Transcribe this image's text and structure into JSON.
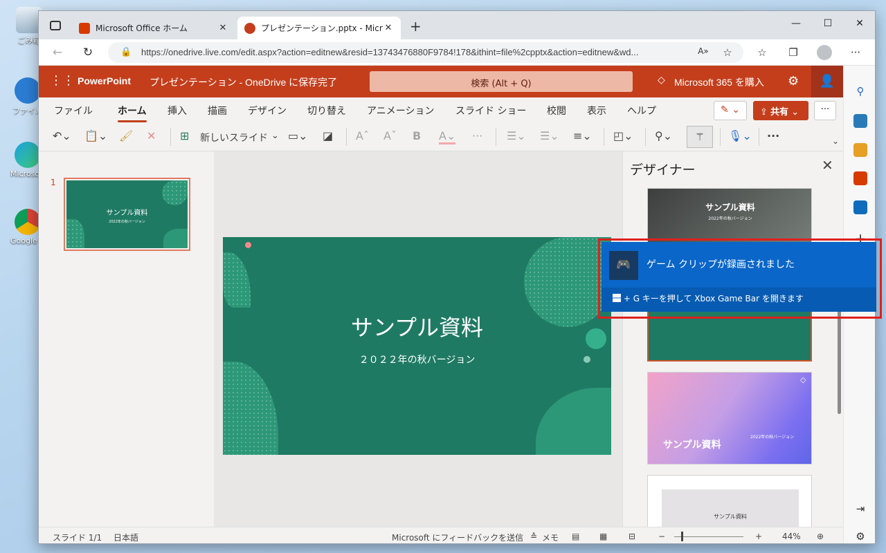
{
  "desktop": {
    "icons": [
      {
        "label": "ごみ箱"
      },
      {
        "label": "ファイル"
      },
      {
        "label": "Microsoft"
      },
      {
        "label": "Google C"
      }
    ]
  },
  "browser": {
    "tabs": [
      {
        "title": "Microsoft Office ホーム"
      },
      {
        "title": "プレゼンテーション.pptx - Microsoft PowerPoint"
      }
    ],
    "url": "https://onedrive.live.com/edit.aspx?action=editnew&resid=13743476880F9784!178&ithint=file%2cpptx&action=editnew&wd..."
  },
  "ppt": {
    "app_name": "PowerPoint",
    "doc_status": "プレゼンテーション - OneDrive に保存完了",
    "search_placeholder": "検索 (Alt + Q)",
    "buy_label": "Microsoft 365 を購入",
    "menu": [
      "ファイル",
      "ホーム",
      "挿入",
      "描画",
      "デザイン",
      "切り替え",
      "アニメーション",
      "スライド ショー",
      "校閲",
      "表示",
      "ヘルプ"
    ],
    "share_label": "共有",
    "new_slide_label": "新しいスライド",
    "slide_number": "1",
    "slide_title": "サンプル資料",
    "slide_subtitle": "２０２２年の秋バージョン",
    "thumb_title": "サンプル資料",
    "thumb_subtitle": "2022年の秋バージョン",
    "designer": {
      "title": "デザイナー",
      "cards": [
        {
          "title": "サンプル資料",
          "subtitle": "2022年の秋バージョン"
        },
        {
          "title": "サンプル資料",
          "subtitle": "2022年の秋バージョン"
        },
        {
          "title": "サンプル資料"
        }
      ]
    },
    "status": {
      "slide_count": "スライド 1/1",
      "language": "日本語",
      "feedback": "Microsoft にフィードバックを送信",
      "notes": "メモ",
      "zoom": "44%"
    }
  },
  "toast": {
    "title": "ゲーム クリップが録画されました",
    "footer": "+ G キーを押して Xbox Game Bar を開きます"
  }
}
